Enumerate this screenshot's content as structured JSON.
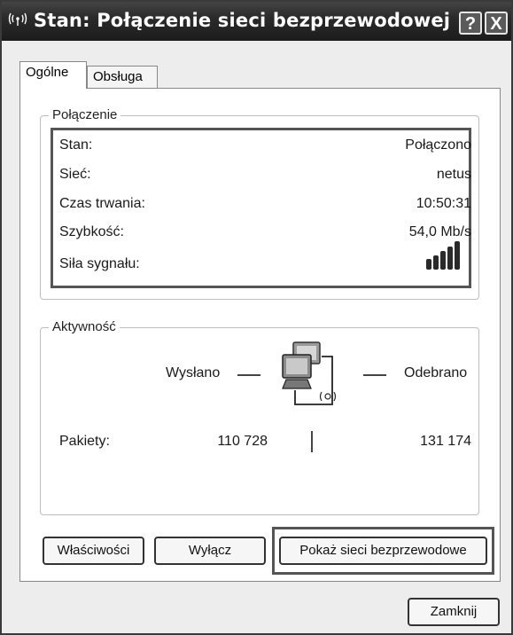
{
  "window": {
    "title": "Stan: Połączenie sieci bezprzewodowej",
    "title_icon": "wireless-icon",
    "help_label": "?",
    "close_label": "X"
  },
  "tabs": [
    {
      "label": "Ogólne",
      "active": true
    },
    {
      "label": "Obsługa",
      "active": false
    }
  ],
  "connection": {
    "group_label": "Połączenie",
    "rows": [
      {
        "label": "Stan:",
        "value": "Połączono"
      },
      {
        "label": "Sieć:",
        "value": "netus"
      },
      {
        "label": "Czas trwania:",
        "value": "10:50:31"
      },
      {
        "label": "Szybkość:",
        "value": "54,0 Mb/s"
      },
      {
        "label": "Siła sygnału:",
        "value": "",
        "icon": "signal-strength-icon",
        "bars_lit": 5,
        "bars_total": 5
      }
    ]
  },
  "activity": {
    "group_label": "Aktywność",
    "sent_label": "Wysłano",
    "received_label": "Odebrano",
    "packets_label": "Pakiety:",
    "packets_sent": "110 728",
    "packets_received": "131 174",
    "icon": "network-computers-icon"
  },
  "buttons": {
    "properties": "Właściwości",
    "disable": "Wyłącz",
    "show_networks": "Pokaż sieci bezprzewodowe",
    "close": "Zamknij"
  }
}
